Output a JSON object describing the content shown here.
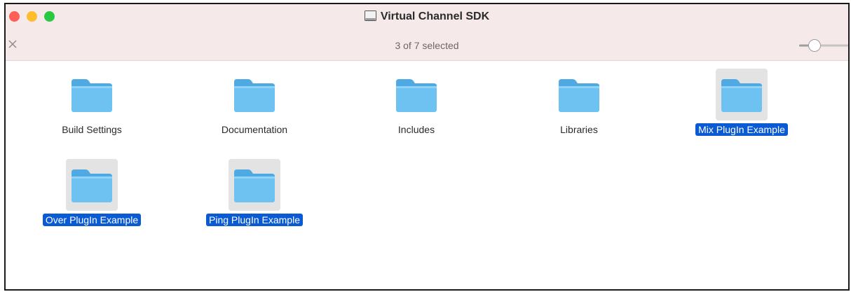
{
  "window": {
    "title": "Virtual Channel SDK",
    "status_text": "3 of 7 selected"
  },
  "items": [
    {
      "name": "Build Settings",
      "selected": false
    },
    {
      "name": "Documentation",
      "selected": false
    },
    {
      "name": "Includes",
      "selected": false
    },
    {
      "name": "Libraries",
      "selected": false
    },
    {
      "name": "Mix PlugIn Example",
      "selected": true
    },
    {
      "name": "Over PlugIn Example",
      "selected": true
    },
    {
      "name": "Ping PlugIn Example",
      "selected": true
    }
  ],
  "icons": {
    "folder": "folder-icon",
    "title_disk": "disk-icon",
    "toolbar_close": "close-icon",
    "zoom": "zoom-slider"
  },
  "colors": {
    "titlebar_bg": "#f6e9e9",
    "selection": "#0a5ad4",
    "folder_body": "#6ec2f2",
    "folder_tab": "#4fa9e3"
  }
}
